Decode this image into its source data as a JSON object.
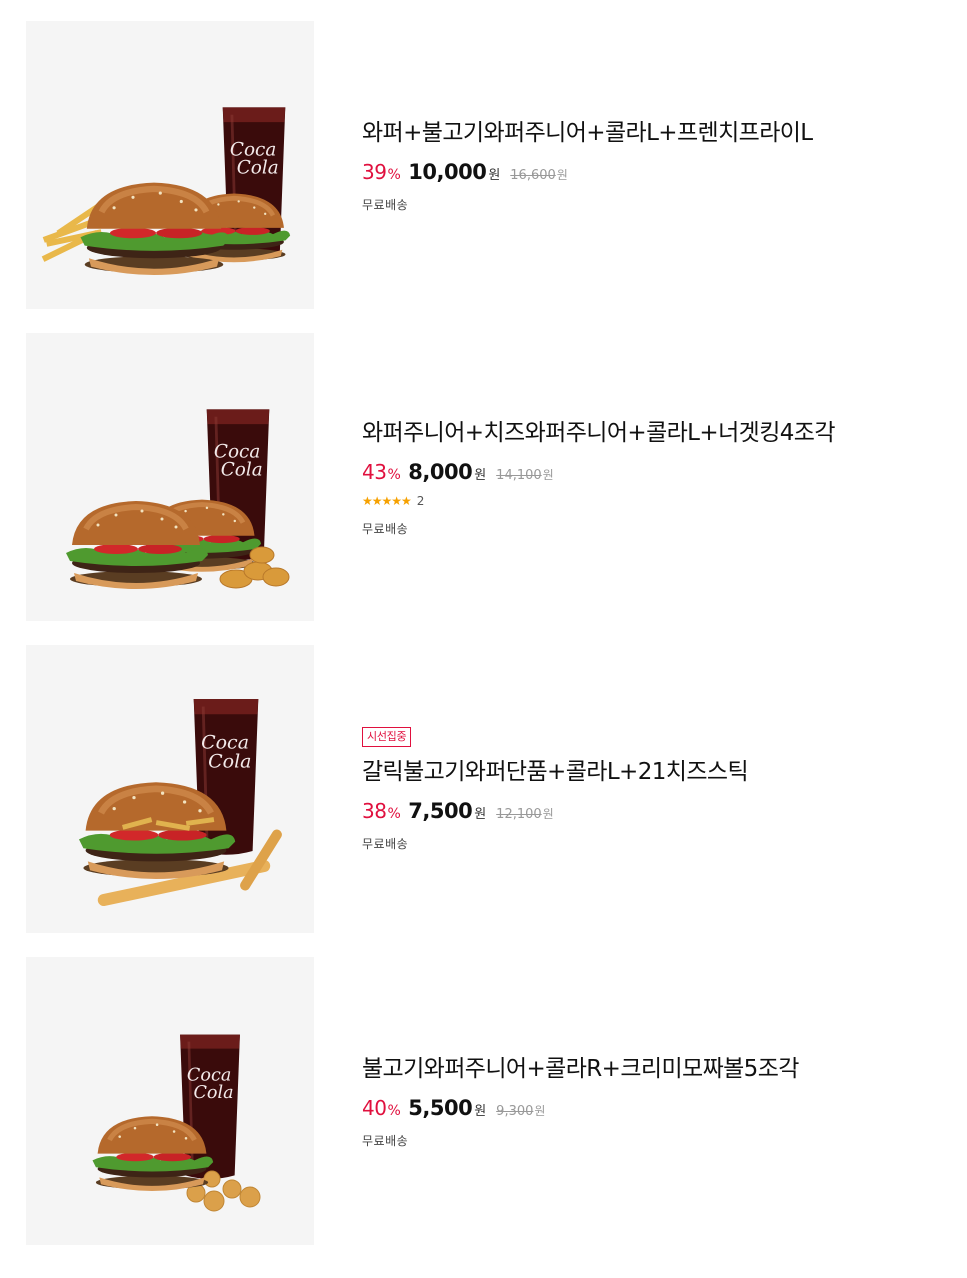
{
  "currency": "원",
  "percent_sign": "%",
  "products": [
    {
      "title": "와퍼+불고기와퍼주니어+콜라L+프렌치프라이L",
      "discount": "39",
      "sale_price": "10,000",
      "original_price": "16,600",
      "shipping": "무료배송",
      "image": "burger-set-fries-icon"
    },
    {
      "title": "와퍼주니어+치즈와퍼주니어+콜라L+너겟킹4조각",
      "discount": "43",
      "sale_price": "8,000",
      "original_price": "14,100",
      "rating_stars": "★★★★★",
      "review_count": "2",
      "shipping": "무료배송",
      "image": "burger-set-nuggets-icon"
    },
    {
      "badge": "시선집중",
      "title": "갈릭불고기와퍼단품+콜라L+21치즈스틱",
      "discount": "38",
      "sale_price": "7,500",
      "original_price": "12,100",
      "shipping": "무료배송",
      "image": "burger-set-cheesestick-icon"
    },
    {
      "title": "불고기와퍼주니어+콜라R+크리미모짜볼5조각",
      "discount": "40",
      "sale_price": "5,500",
      "original_price": "9,300",
      "shipping": "무료배송",
      "image": "burger-set-mozzaball-icon"
    }
  ],
  "colors": {
    "accent": "#e0103e",
    "star": "#f6a100",
    "thumb_bg": "#f5f5f5"
  }
}
